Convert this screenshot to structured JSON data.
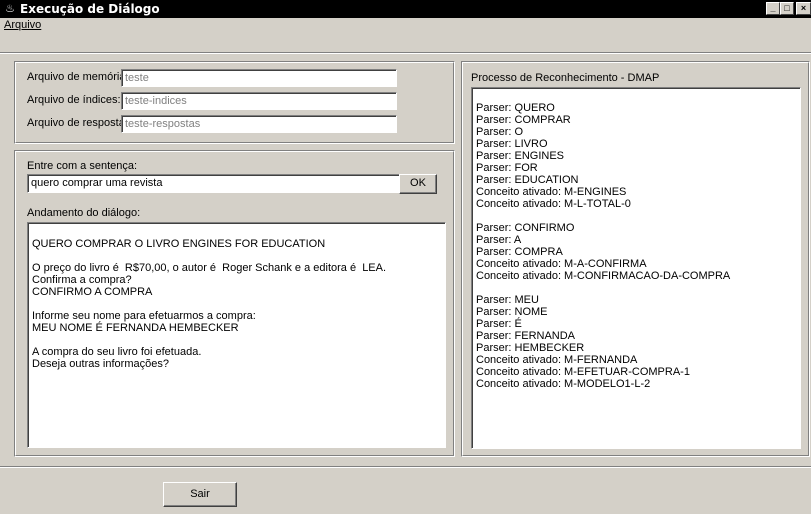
{
  "window": {
    "title": "Execução de Diálogo",
    "icon": "java-cup-icon",
    "buttons": [
      "minimize",
      "maximize",
      "close"
    ],
    "minimize_glyph": "_",
    "maximize_glyph": "□",
    "close_glyph": "×"
  },
  "menu": {
    "arquivo": "Arquivo"
  },
  "files": {
    "memoria_label": "Arquivo de memória:",
    "memoria_value": "teste",
    "indices_label": "Arquivo de índices:",
    "indices_value": "teste-indices",
    "respostas_label": "Arquivo de respostas:",
    "respostas_value": "teste-respostas"
  },
  "input": {
    "label": "Entre com a sentença:",
    "value": "quero comprar uma revista",
    "ok_label": "OK"
  },
  "dialog": {
    "label": "Andamento do diálogo:",
    "lines": [
      "QUERO COMPRAR O LIVRO ENGINES FOR EDUCATION",
      "",
      "O preço do livro é  R$70,00, o autor é  Roger Schank e a editora é  LEA.",
      "Confirma a compra?",
      "CONFIRMO A COMPRA",
      "",
      "Informe seu nome para efetuarmos a compra:",
      "MEU NOME É FERNANDA HEMBECKER",
      "",
      "A compra do seu livro foi efetuada.",
      "Deseja outras informações?"
    ]
  },
  "process": {
    "label": "Processo de Reconhecimento - DMAP",
    "lines": [
      "Parser: QUERO",
      "Parser: COMPRAR",
      "Parser: O",
      "Parser: LIVRO",
      "Parser: ENGINES",
      "Parser: FOR",
      "Parser: EDUCATION",
      "Conceito ativado: M-ENGINES",
      "Conceito ativado: M-L-TOTAL-0",
      "",
      "Parser: CONFIRMO",
      "Parser: A",
      "Parser: COMPRA",
      "Conceito ativado: M-A-CONFIRMA",
      "Conceito ativado: M-CONFIRMACAO-DA-COMPRA",
      "",
      "Parser: MEU",
      "Parser: NOME",
      "Parser: É",
      "Parser: FERNANDA",
      "Parser: HEMBECKER",
      "Conceito ativado: M-FERNANDA",
      "Conceito ativado: M-EFETUAR-COMPRA-1",
      "Conceito ativado: M-MODELO1-L-2"
    ]
  },
  "footer": {
    "sair_label": "Sair"
  }
}
